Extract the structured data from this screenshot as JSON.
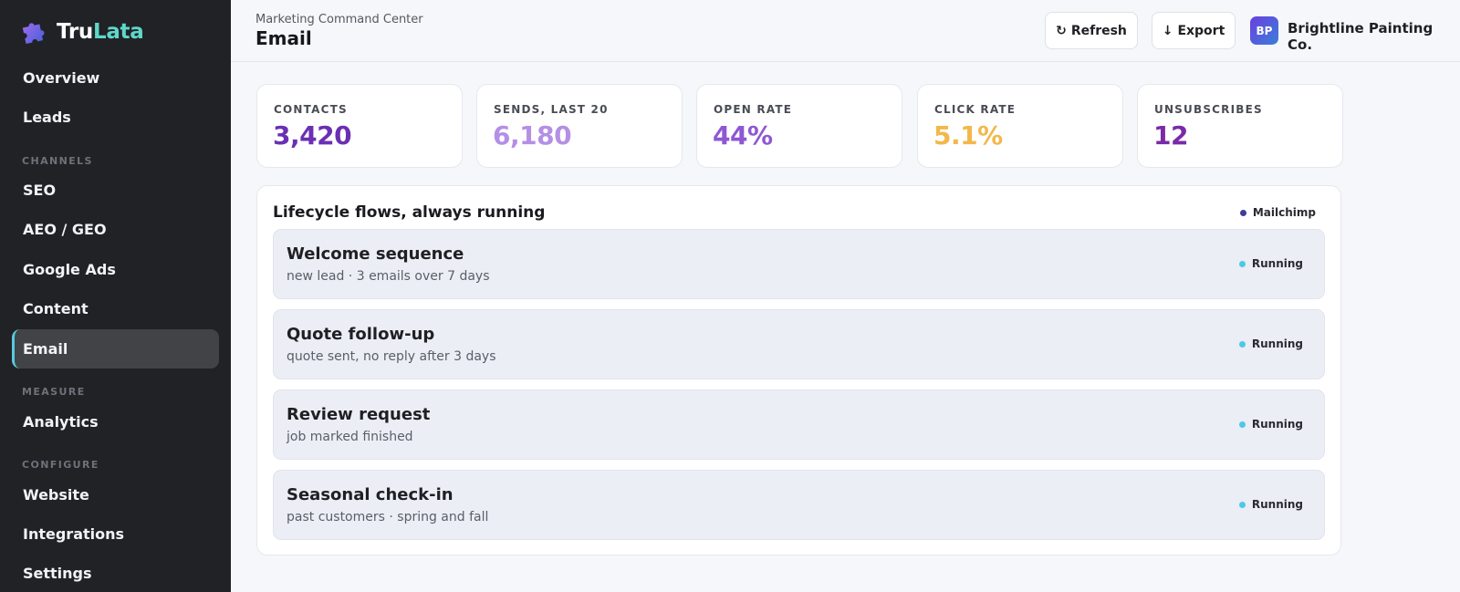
{
  "brand": {
    "name_part1": "Tru",
    "name_part2": "Lata",
    "icon": "puzzle-logo-icon"
  },
  "sidebar": {
    "items": [
      {
        "label": "Overview"
      },
      {
        "label": "Leads"
      },
      {
        "label": "SEO"
      },
      {
        "label": "AEO / GEO"
      },
      {
        "label": "Google Ads"
      },
      {
        "label": "Content"
      },
      {
        "label": "Email",
        "active": true
      },
      {
        "label": "Analytics"
      },
      {
        "label": "Website"
      },
      {
        "label": "Integrations"
      },
      {
        "label": "Settings"
      }
    ],
    "sections": {
      "channels": "CHANNELS",
      "measure": "MEASURE",
      "configure": "CONFIGURE"
    }
  },
  "header": {
    "eyebrow": "Marketing Command Center",
    "title": "Email",
    "refresh_label": "Refresh",
    "refresh_icon": "refresh-icon",
    "export_label": "Export",
    "export_icon": "download-arrow-icon",
    "avatar_initials": "BP",
    "company": "Brightline Painting Co."
  },
  "stats": [
    {
      "label": "CONTACTS",
      "value": "3,420",
      "color": "#6b2fb3"
    },
    {
      "label": "SENDS, LAST 20",
      "value": "6,180",
      "color": "#b48fe6"
    },
    {
      "label": "OPEN RATE",
      "value": "44%",
      "color": "#8e57d4"
    },
    {
      "label": "CLICK RATE",
      "value": "5.1%",
      "color": "#f2b84a"
    },
    {
      "label": "UNSUBSCRIBES",
      "value": "12",
      "color": "#7a2aa8"
    }
  ],
  "flows": {
    "title": "Lifecycle flows, always running",
    "provider": "Mailchimp",
    "provider_dot_color": "#3b3d9c",
    "status_dot_color": "#4cc9e6",
    "items": [
      {
        "name": "Welcome sequence",
        "desc": "new lead · 3 emails over 7 days",
        "status": "Running"
      },
      {
        "name": "Quote follow-up",
        "desc": "quote sent, no reply after 3 days",
        "status": "Running"
      },
      {
        "name": "Review request",
        "desc": "job marked finished",
        "status": "Running"
      },
      {
        "name": "Seasonal check-in",
        "desc": "past customers · spring and fall",
        "status": "Running"
      }
    ]
  }
}
